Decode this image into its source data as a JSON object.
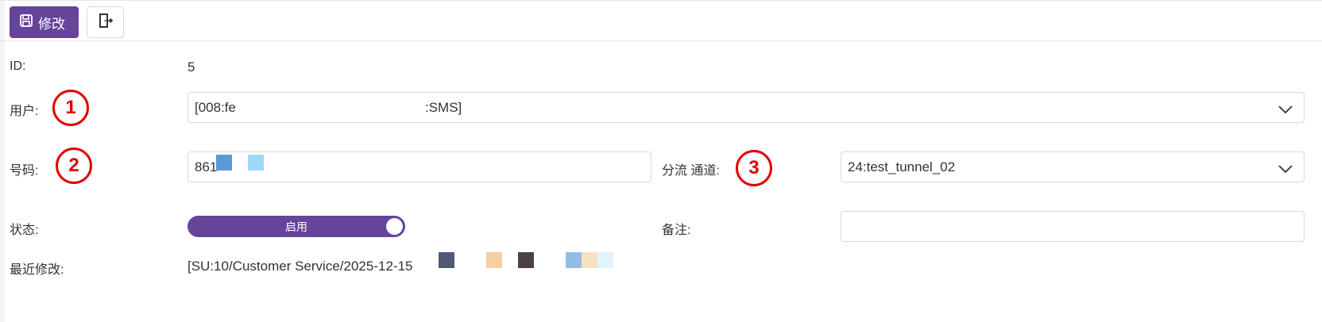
{
  "toolbar": {
    "save_label": "修改",
    "save_icon": "save-icon",
    "exit_icon": "exit-door-icon"
  },
  "form": {
    "id_label": "ID:",
    "id_value": "5",
    "user_label": "用户:",
    "user_value_start": "[008:fe",
    "user_value_end": ":SMS]",
    "phone_label": "号码:",
    "phone_value": "861",
    "channel_label": "分流 通道:",
    "channel_value": "24:test_tunnel_02",
    "status_label": "状态:",
    "status_value": "启用",
    "remark_label": "备注:",
    "remark_value": "",
    "last_modified_label": "最近修改:",
    "last_modified_value": "[SU:10/Customer Service/2025-12-15"
  },
  "annotations": [
    "1",
    "2",
    "3"
  ],
  "colors": {
    "accent": "#66449a",
    "marker": "#e00000"
  }
}
